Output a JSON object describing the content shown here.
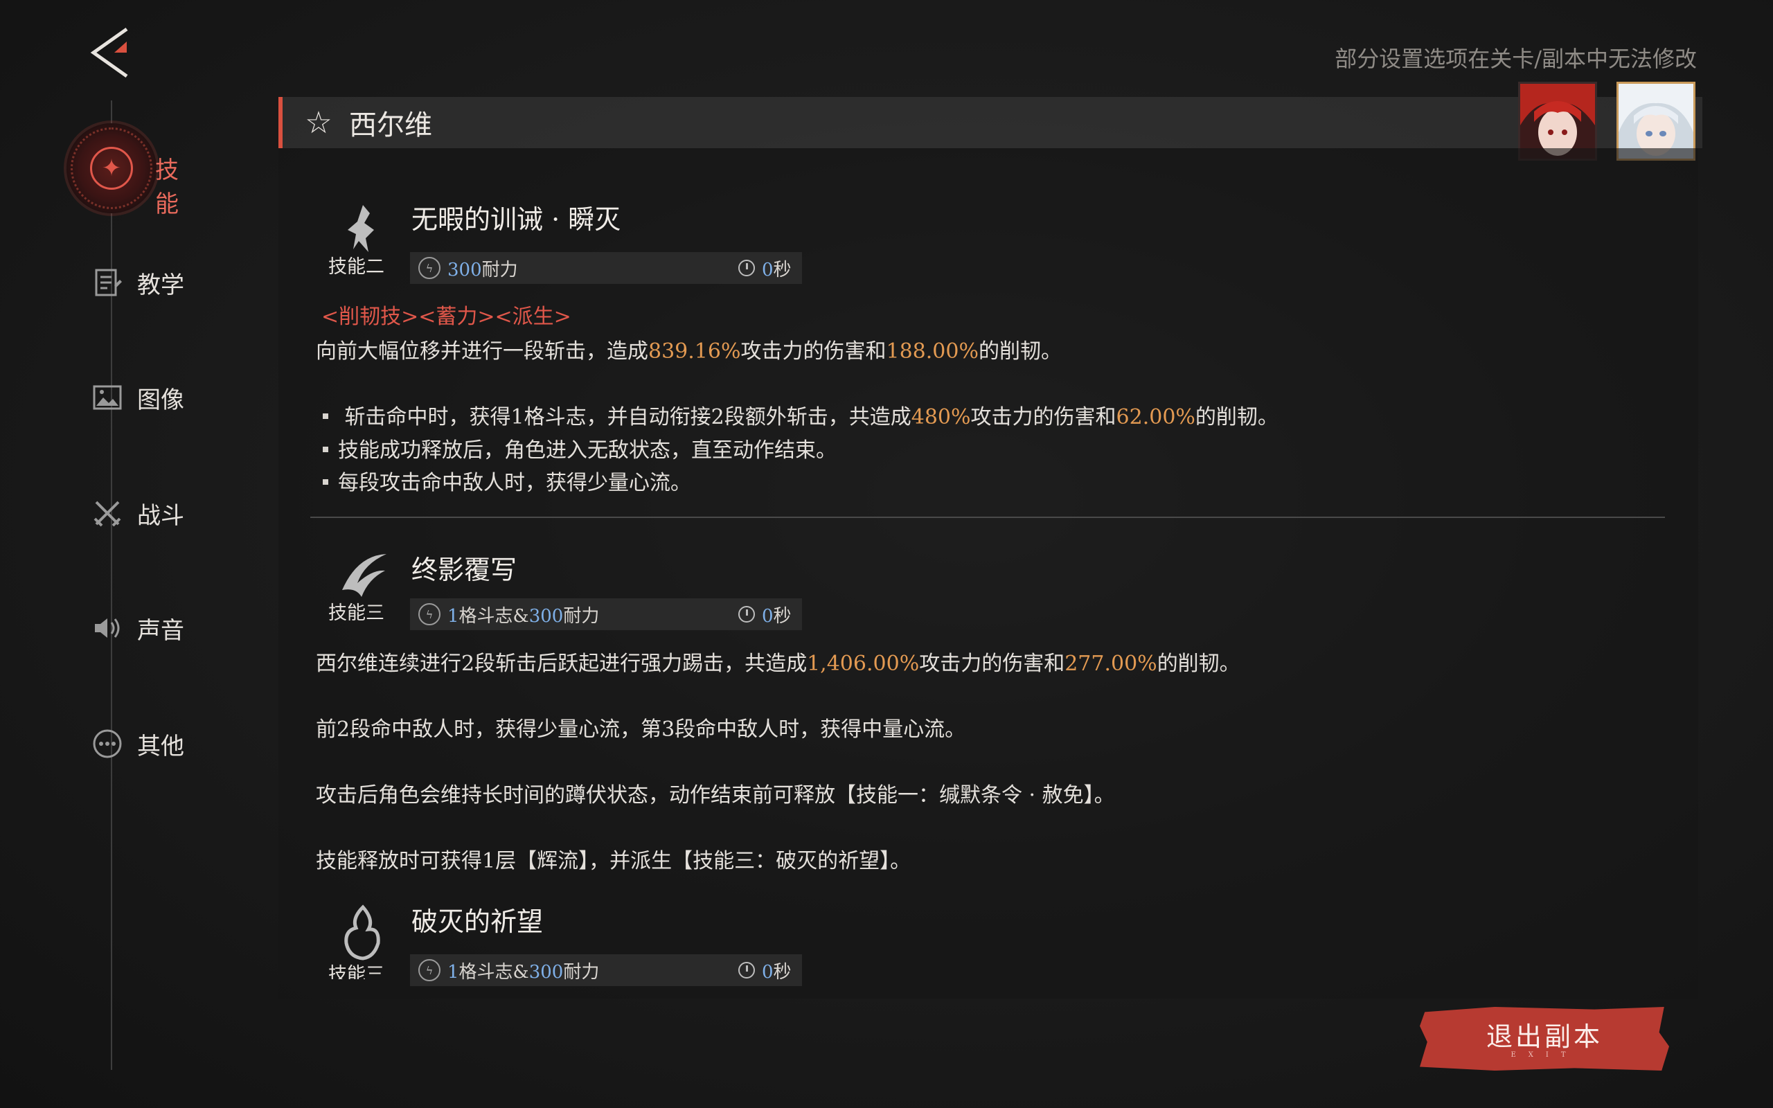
{
  "hint": "部分设置选项在关卡/副本中无法修改",
  "nav": {
    "active": "技能",
    "items": [
      "教学",
      "图像",
      "战斗",
      "声音",
      "其他"
    ]
  },
  "header": {
    "character_name": "西尔维"
  },
  "skills": [
    {
      "name": "无暇的训诫 · 瞬灭",
      "slot": "技能二",
      "cost_prefix": "",
      "cost_value": "300",
      "cost_suffix": "耐力",
      "cd_value": "0",
      "cd_unit": "秒",
      "tags": "<削韧技><蓄力><派生>",
      "desc": [
        "向前大幅位移并进行一段斩击，造成",
        "839.16%",
        "攻击力的伤害和",
        "188.00%",
        "的削韧。"
      ],
      "bullets": [
        [
          "斩击命中时，获得1格斗志，并自动衔接2段额外斩击，共造成",
          "480%",
          "攻击力的伤害和",
          "62.00%",
          "的削韧。"
        ],
        [
          "技能成功释放后，角色进入无敌状态，直至动作结束。"
        ],
        [
          "每段攻击命中敌人时，获得少量心流。"
        ]
      ]
    },
    {
      "name": "终影覆写",
      "slot": "技能三",
      "cost_prefix": "1",
      "cost_mid": "格斗志&",
      "cost_value": "300",
      "cost_suffix": "耐力",
      "cd_value": "0",
      "cd_unit": "秒",
      "desc": [
        "西尔维连续进行2段斩击后跃起进行强力踢击，共造成",
        "1,406.00%",
        "攻击力的伤害和",
        "277.00%",
        "的削韧。"
      ],
      "lines": [
        "前2段命中敌人时，获得少量心流，第3段命中敌人时，获得中量心流。",
        "攻击后角色会维持长时间的蹲伏状态，动作结束前可释放【技能一：缄默条令 · 赦免】。",
        "技能释放时可获得1层【辉流】，并派生【技能三：破灭的祈望】。"
      ]
    },
    {
      "name": "破灭的祈望",
      "slot": "技能三",
      "cost_prefix": "1",
      "cost_mid": "格斗志&",
      "cost_value": "300",
      "cost_suffix": "耐力",
      "cd_value": "0",
      "cd_unit": "秒"
    }
  ],
  "exit_button": {
    "label": "退出副本",
    "sub": "EXIT"
  },
  "colors": {
    "accent_red": "#d9503f",
    "highlight_orange": "#e39a52",
    "value_blue": "#7fb0e8"
  }
}
